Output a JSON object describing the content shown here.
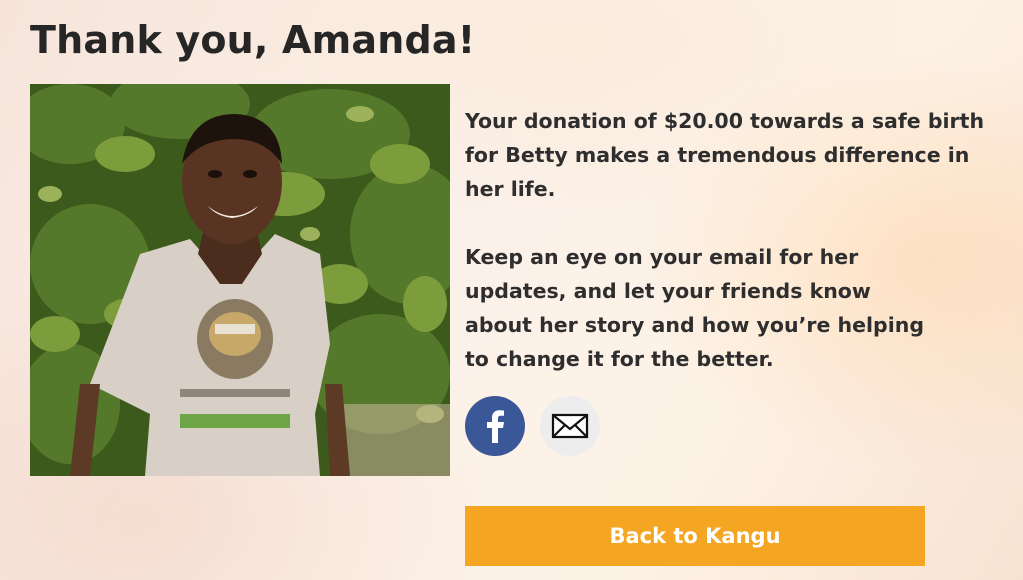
{
  "header": {
    "title": "Thank you, Amanda!"
  },
  "photo": {
    "alt": "Betty"
  },
  "message": {
    "paragraph1": "Your donation of $20.00 towards a safe birth for Betty makes a tremendous difference in her life.",
    "paragraph2": "Keep an eye on your email for her updates, and let your friends know about her story and how you’re helping to change it for the better."
  },
  "share": {
    "facebook": {
      "icon": "facebook-icon",
      "color": "#3a5898"
    },
    "email": {
      "icon": "envelope-icon",
      "color": "#ededed"
    }
  },
  "cta": {
    "label": "Back to Kangu",
    "color": "#f4a622"
  },
  "colors": {
    "text": "#2e2e2e",
    "title": "#262626"
  }
}
